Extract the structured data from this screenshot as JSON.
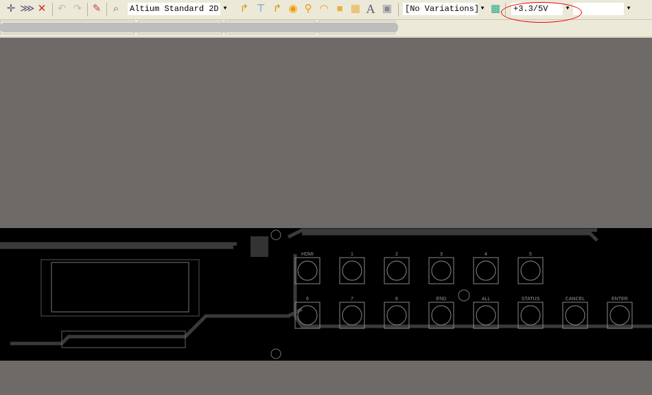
{
  "toolbar": {
    "icons": [
      "move-icon",
      "select-icon",
      "clear-filter-icon",
      "undo-icon",
      "redo-icon",
      "pen-icon",
      "inspect-icon",
      "route-icon",
      "fanout-icon",
      "interactive-route-icon",
      "pad-icon",
      "via-icon",
      "arc-icon",
      "fill-icon",
      "polygon-icon",
      "text-icon",
      "component-icon",
      "board-icon"
    ],
    "view_select": "Altium Standard 2D",
    "variation_select": "[No Variations]",
    "net_select": "+3.3/5V",
    "class_select": ""
  },
  "pcb": {
    "top_keys": [
      "HDMI",
      "1",
      "2",
      "3",
      "4",
      "5"
    ],
    "bottom_keys": [
      "6",
      "7",
      "8",
      "END",
      "ALL",
      "STATUS",
      "CANCEL",
      "ENTER"
    ],
    "colors": {
      "board": "#000000",
      "track": "#3a3a3a",
      "silk": "#8a8a8a",
      "background": "#6e6a68"
    }
  }
}
